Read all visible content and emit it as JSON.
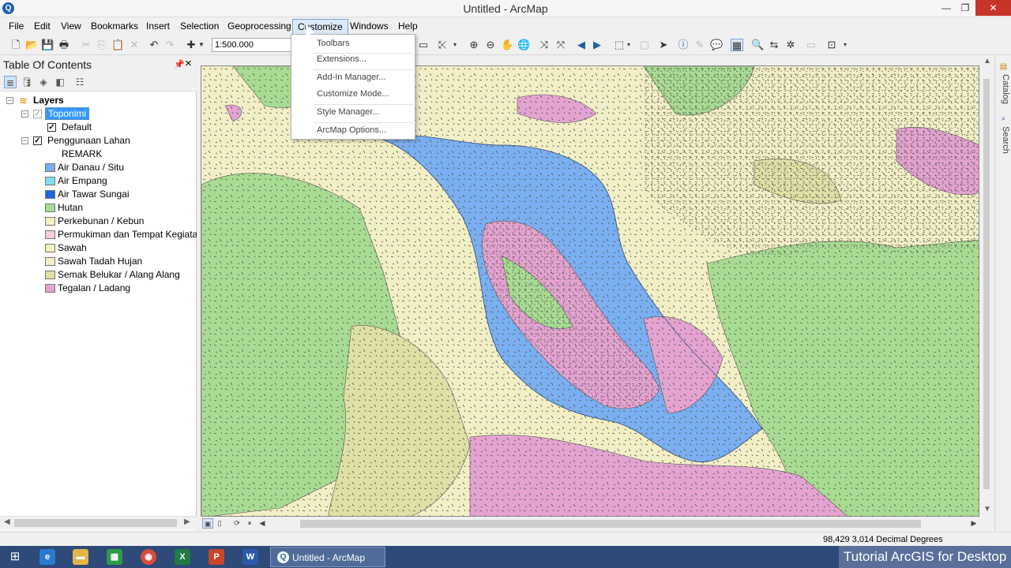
{
  "window": {
    "title": "Untitled - ArcMap"
  },
  "menubar": {
    "items": [
      "File",
      "Edit",
      "View",
      "Bookmarks",
      "Insert",
      "Selection",
      "Geoprocessing",
      "Customize",
      "Windows",
      "Help"
    ],
    "active": "Customize"
  },
  "toolbar": {
    "scale": "1:500.000"
  },
  "customize_menu": {
    "items": [
      "Toolbars",
      "Extensions...",
      "Add-In Manager...",
      "Customize Mode...",
      "Style Manager...",
      "ArcMap Options..."
    ]
  },
  "toc": {
    "title": "Table Of Contents",
    "root": "Layers",
    "layers": [
      {
        "name": "Toponimi",
        "selected": true,
        "checked": true,
        "children": [
          "Default"
        ]
      },
      {
        "name": "Penggunaan Lahan",
        "checked": true,
        "field": "REMARK",
        "classes": [
          {
            "label": "Air Danau / Situ",
            "color": "#79aef2"
          },
          {
            "label": "Air Empang",
            "color": "#7fdcf5"
          },
          {
            "label": "Air Tawar Sungai",
            "color": "#1c64e8"
          },
          {
            "label": "Hutan",
            "color": "#a9dc93"
          },
          {
            "label": "Perkebunan / Kebun",
            "color": "#f3f0c2"
          },
          {
            "label": "Permukiman dan Tempat Kegiatan",
            "color": "#f7cbd5"
          },
          {
            "label": "Sawah",
            "color": "#f4f0c4"
          },
          {
            "label": "Sawah Tadah Hujan",
            "color": "#f4efc7"
          },
          {
            "label": "Semak Belukar / Alang Alang",
            "color": "#dfe0a6"
          },
          {
            "label": "Tegalan / Ladang",
            "color": "#e4a3d1"
          }
        ]
      }
    ]
  },
  "right_rail": {
    "tabs": [
      "Catalog",
      "Search"
    ]
  },
  "status": {
    "coordinates": "98,429  3,014 Decimal Degrees"
  },
  "taskbar": {
    "active_task": "Untitled - ArcMap"
  },
  "watermark": "Tutorial ArcGIS for Desktop"
}
